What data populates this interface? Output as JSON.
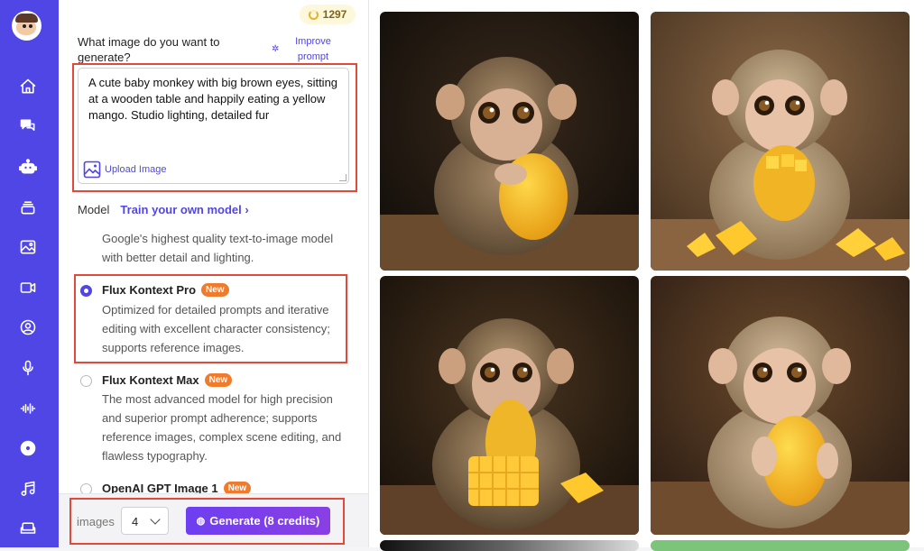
{
  "app": {
    "logo_name": "app-logo"
  },
  "rail": {
    "items": [
      {
        "name": "home-icon"
      },
      {
        "name": "chat-icon"
      },
      {
        "name": "robot-icon"
      },
      {
        "name": "layers-icon"
      },
      {
        "name": "image-gallery-icon"
      },
      {
        "name": "video-icon"
      },
      {
        "name": "user-circle-icon"
      },
      {
        "name": "microphone-icon"
      },
      {
        "name": "audio-wave-icon"
      },
      {
        "name": "disc-icon"
      },
      {
        "name": "music-icon"
      },
      {
        "name": "sofa-icon"
      }
    ],
    "color": "#4f46e5"
  },
  "credits": {
    "value": "1297"
  },
  "prompt": {
    "label": "What image do you want to generate?",
    "improve_label": "Improve prompt",
    "value": "A cute baby monkey with big brown eyes, sitting at a wooden table and happily eating a yellow mango. Studio lighting, detailed fur",
    "upload_label": "Upload Image"
  },
  "model": {
    "label": "Model",
    "train_link": "Train your own model ›",
    "prev_description": "Google's highest quality text-to-image model with better detail and lighting.",
    "options": [
      {
        "title": "Flux Kontext Pro",
        "badge": "New",
        "selected": true,
        "description": "Optimized for detailed prompts and iterative editing with excellent character consistency; supports reference images."
      },
      {
        "title": "Flux Kontext Max",
        "badge": "New",
        "selected": false,
        "description": "The most advanced model for high precision and superior prompt adherence; supports reference images, complex scene editing, and flawless typography."
      },
      {
        "title": "OpenAI GPT Image 1",
        "badge": "New",
        "selected": false
      }
    ]
  },
  "footer": {
    "images_label": "images",
    "count_value": "4",
    "generate_label": "Generate (8 credits)"
  },
  "gallery": {
    "images": [
      {
        "name": "generated-image-1",
        "variant": "whole-mango-dark"
      },
      {
        "name": "generated-image-2",
        "variant": "cubed-mango-light"
      },
      {
        "name": "generated-image-3",
        "variant": "cubed-mango-dark"
      },
      {
        "name": "generated-image-4",
        "variant": "whole-mango-warm"
      }
    ]
  },
  "colors": {
    "accent": "#4f46e5",
    "badge": "#f07b2c",
    "highlight_box": "#e04a3a",
    "generate_button": "#7c3aed"
  }
}
